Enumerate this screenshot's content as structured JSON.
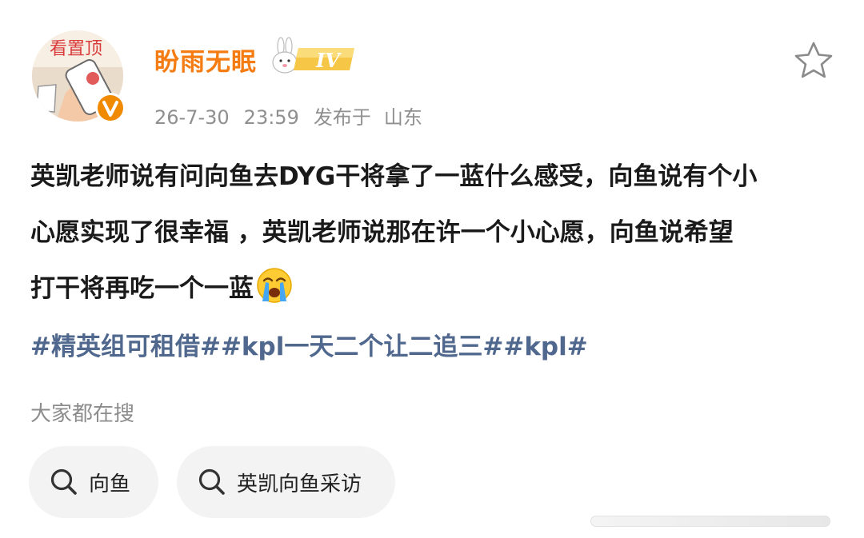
{
  "user": {
    "name": "盼雨无眠",
    "level": "IV",
    "avatar_sticker_text": "看置顶",
    "verified": true
  },
  "meta": {
    "date": "26-7-30",
    "time": "23:59",
    "posted_from_label": "发布于",
    "location": "山东"
  },
  "post": {
    "lines": [
      "英凯老师说有问向鱼去DYG干将拿了一蓝什么感受，向鱼说有个小",
      "心愿实现了很幸福 ，英凯老师说那在许一个小心愿，向鱼说希望",
      "打干将再吃一个一蓝"
    ],
    "emoji": "crying-emoji"
  },
  "hashtags": [
    "#精英组可租借#",
    "#kpl一天二个让二追三#",
    "#kpl#"
  ],
  "search": {
    "heading": "大家都在搜",
    "chips": [
      "向鱼",
      "英凯向鱼采访"
    ]
  },
  "colors": {
    "username": "#f57c12",
    "hashtag": "#50688e",
    "verified": "#f08a00",
    "meta": "#8f8f8f"
  }
}
